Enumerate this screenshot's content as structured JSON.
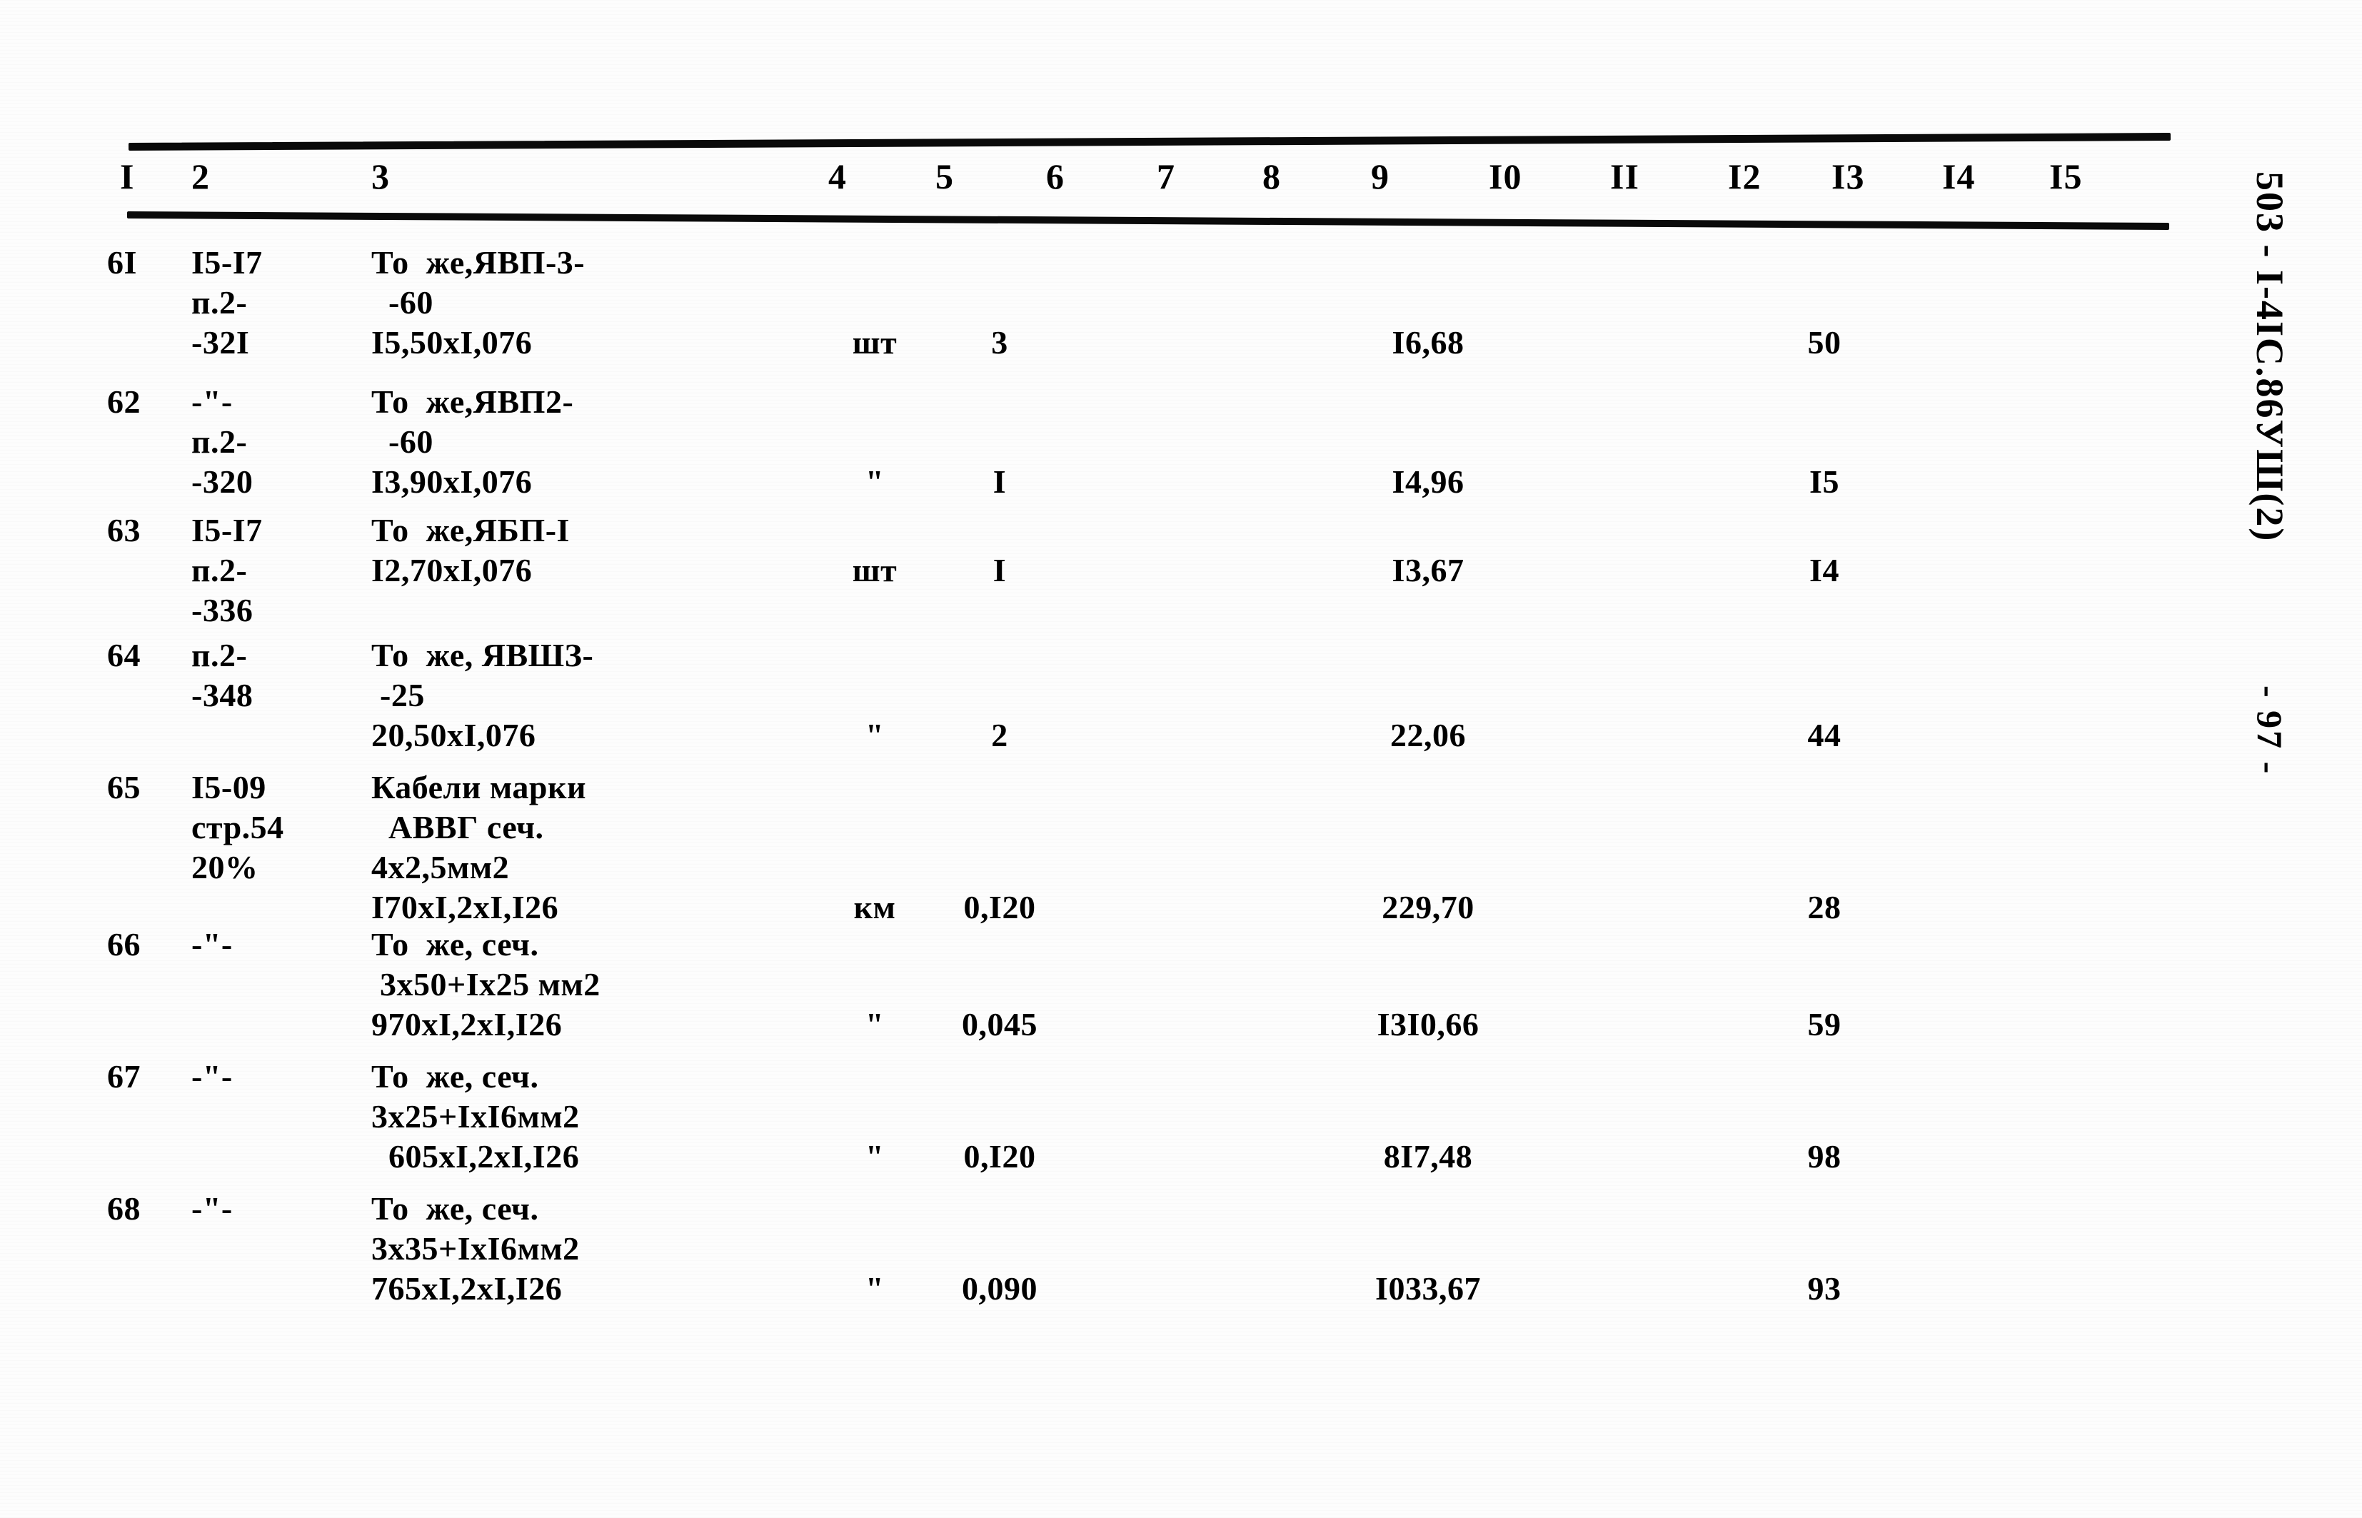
{
  "document": {
    "margin_code": "503 - I-4IC.86УШ(2)",
    "page_number": "- 97 -"
  },
  "table": {
    "column_headers": [
      "I",
      "2",
      "3",
      "4",
      "5",
      "6",
      "7",
      "8",
      "9",
      "I0",
      "II",
      "I2",
      "I3",
      "I4",
      "I5"
    ],
    "rows": [
      {
        "num": "6I",
        "code": "I5-I7\nп.2-\n-32I",
        "desc": "То  же,ЯВП-3-\n  -60\nI5,50xI,076",
        "unit": "шт",
        "qty": "3",
        "price": "I6,68",
        "total": "50"
      },
      {
        "num": "62",
        "code": "-\"-\nп.2-\n-320",
        "desc": "То  же,ЯВП2-\n  -60\nI3,90xI,076",
        "unit": "\"",
        "qty": "I",
        "price": "I4,96",
        "total": "I5"
      },
      {
        "num": "63",
        "code": "I5-I7\nп.2-\n-336",
        "desc": "То  же,ЯБП-I\nI2,70xI,076",
        "unit": "шт",
        "qty": "I",
        "price": "I3,67",
        "total": "I4"
      },
      {
        "num": "64",
        "code": "п.2-\n-348",
        "desc": "То  же, ЯВШЗ-\n -25\n20,50xI,076",
        "unit": "\"",
        "qty": "2",
        "price": "22,06",
        "total": "44"
      },
      {
        "num": "65",
        "code": "I5-09\nстр.54\n20%",
        "desc": "Кабели марки\n  АВВГ сеч.\n4x2,5мм2\nI70xI,2xI,I26",
        "unit": "км",
        "qty": "0,I20",
        "price": "229,70",
        "total": "28"
      },
      {
        "num": "66",
        "code": "-\"-",
        "desc": "То  же, сеч.\n 3x50+Ix25 мм2\n970xI,2xI,I26",
        "unit": "\"",
        "qty": "0,045",
        "price": "I3I0,66",
        "total": "59"
      },
      {
        "num": "67",
        "code": "-\"-",
        "desc": "То  же, сеч.\n3x25+IxI6мм2\n  605xI,2xI,I26",
        "unit": "\"",
        "qty": "0,I20",
        "price": "8I7,48",
        "total": "98"
      },
      {
        "num": "68",
        "code": "-\"-",
        "desc": "То  же, сеч.\n3x35+IxI6мм2\n765xI,2xI,I26",
        "unit": "\"",
        "qty": "0,090",
        "price": "I033,67",
        "total": "93"
      }
    ]
  }
}
